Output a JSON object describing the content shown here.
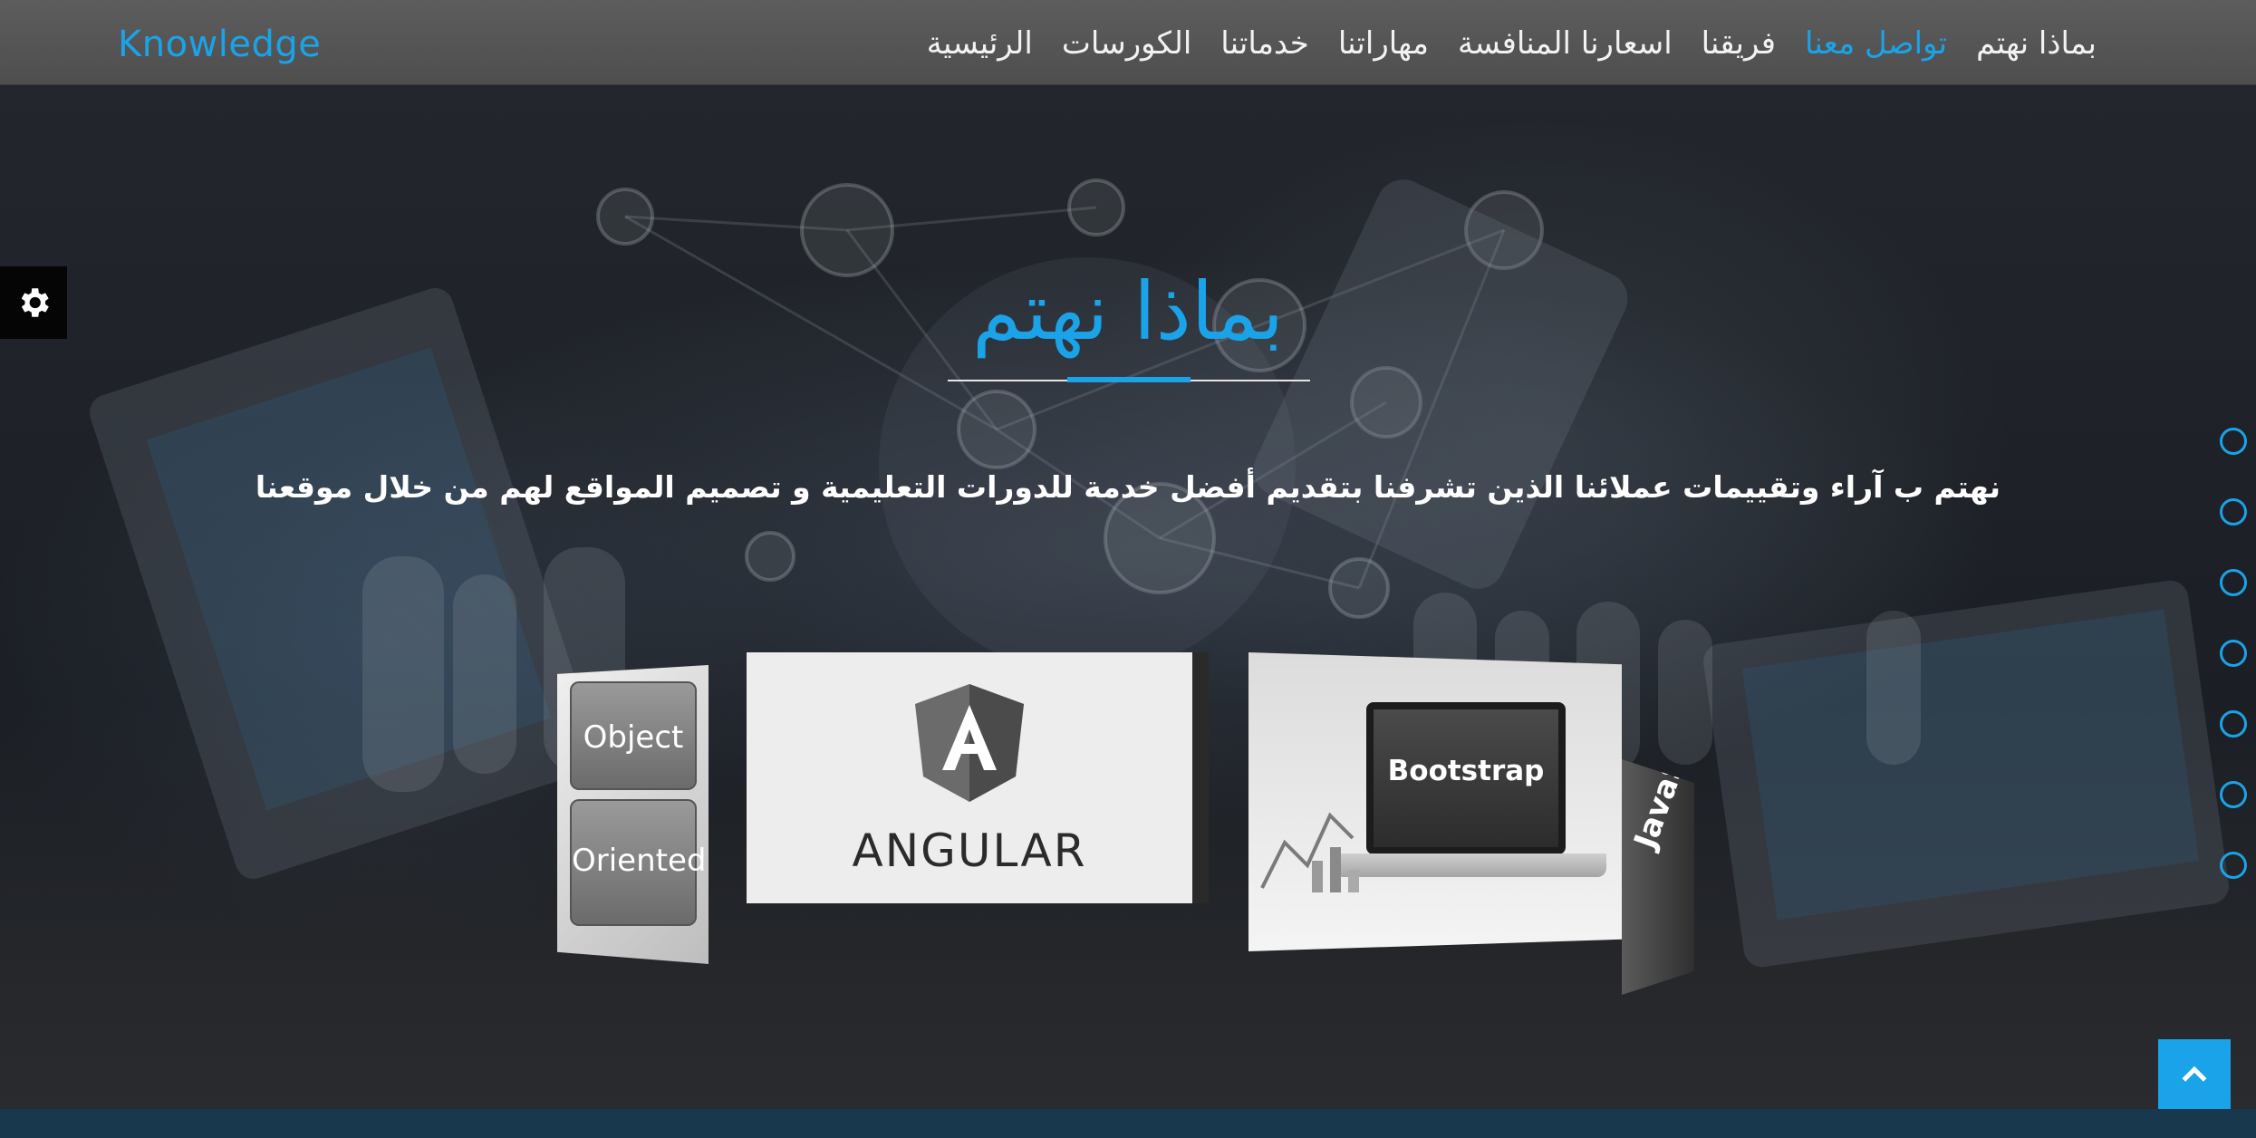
{
  "navbar": {
    "brand": "Knowledge",
    "items": [
      {
        "label": "الرئيسية",
        "active": false
      },
      {
        "label": "الكورسات",
        "active": false
      },
      {
        "label": "خدماتنا",
        "active": false
      },
      {
        "label": "مهاراتنا",
        "active": false
      },
      {
        "label": "اسعارنا المنافسة",
        "active": false
      },
      {
        "label": "فريقنا",
        "active": false
      },
      {
        "label": "تواصل معنا",
        "active": true
      },
      {
        "label": "بماذا نهتم",
        "active": false
      }
    ]
  },
  "hero": {
    "title": "بماذا نهتم",
    "description": "نهتم ب آراء وتقييمات عملائنا الذين تشرفنا بتقديم أفضل خدمة للدورات التعليمية و تصميم المواقع لهم من خلال موقعنا"
  },
  "carousel": {
    "cards": [
      {
        "name": "oop",
        "lines": [
          "Object",
          "Oriented"
        ]
      },
      {
        "name": "angular",
        "label": "ANGULAR"
      },
      {
        "name": "bootstrap",
        "label": "Bootstrap"
      },
      {
        "name": "javascript",
        "label": "JavaScript"
      }
    ]
  },
  "side_nav": {
    "dots": 7
  },
  "icons": {
    "settings": "gear-icon",
    "scroll_top": "chevron-up-icon"
  },
  "colors": {
    "accent": "#1aa3e8",
    "navbar": "#555555",
    "hero_overlay": "#1f2329"
  }
}
